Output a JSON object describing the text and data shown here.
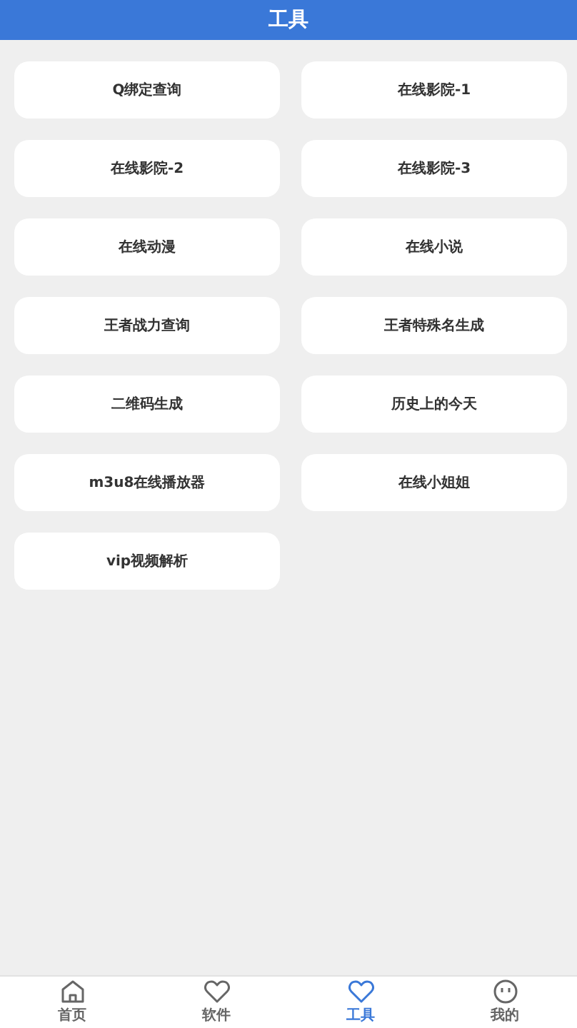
{
  "header": {
    "title": "工具"
  },
  "tools": [
    {
      "label": "Q绑定查询"
    },
    {
      "label": "在线影院-1"
    },
    {
      "label": "在线影院-2"
    },
    {
      "label": "在线影院-3"
    },
    {
      "label": "在线动漫"
    },
    {
      "label": "在线小说"
    },
    {
      "label": "王者战力查询"
    },
    {
      "label": "王者特殊名生成"
    },
    {
      "label": "二维码生成"
    },
    {
      "label": "历史上的今天"
    },
    {
      "label": "m3u8在线播放器"
    },
    {
      "label": "在线小姐姐"
    },
    {
      "label": "vip视频解析"
    }
  ],
  "tab_bar": [
    {
      "label": "首页",
      "kind": "home",
      "selected": false
    },
    {
      "label": "软件",
      "kind": "heart",
      "selected": false
    },
    {
      "label": "工具",
      "kind": "heart",
      "selected": true
    },
    {
      "label": "我的",
      "kind": "face",
      "selected": false
    }
  ]
}
